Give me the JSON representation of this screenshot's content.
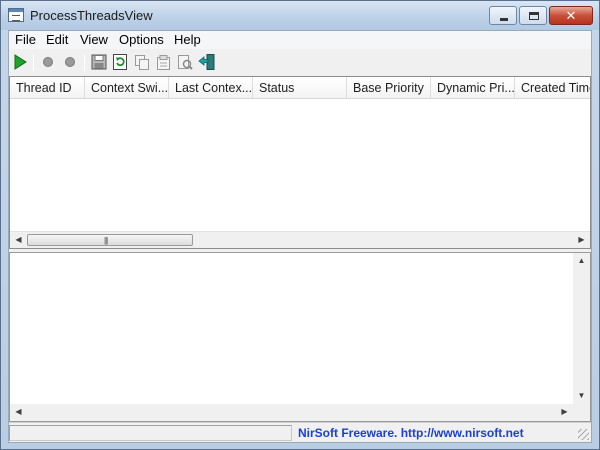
{
  "window": {
    "title": "ProcessThreadsView"
  },
  "menu": [
    "File",
    "Edit",
    "View",
    "Options",
    "Help"
  ],
  "toolbar": {
    "buttons": [
      "play-icon",
      "suspend-thread-icon",
      "resume-thread-icon",
      "save-icon",
      "refresh-icon",
      "copy-icon",
      "properties-icon",
      "html-report-icon",
      "exit-icon"
    ]
  },
  "thread_list": {
    "columns": [
      "Thread ID",
      "Context Swi...",
      "Last Contex...",
      "Status",
      "Base Priority",
      "Dynamic Pri...",
      "Created Time"
    ],
    "rows": []
  },
  "status_bar": {
    "link_text": "NirSoft Freeware.  http://www.nirsoft.net"
  },
  "colors": {
    "link": "#1a3fd6",
    "play_green": "#1fa32a",
    "close_red": "#c9503a"
  }
}
